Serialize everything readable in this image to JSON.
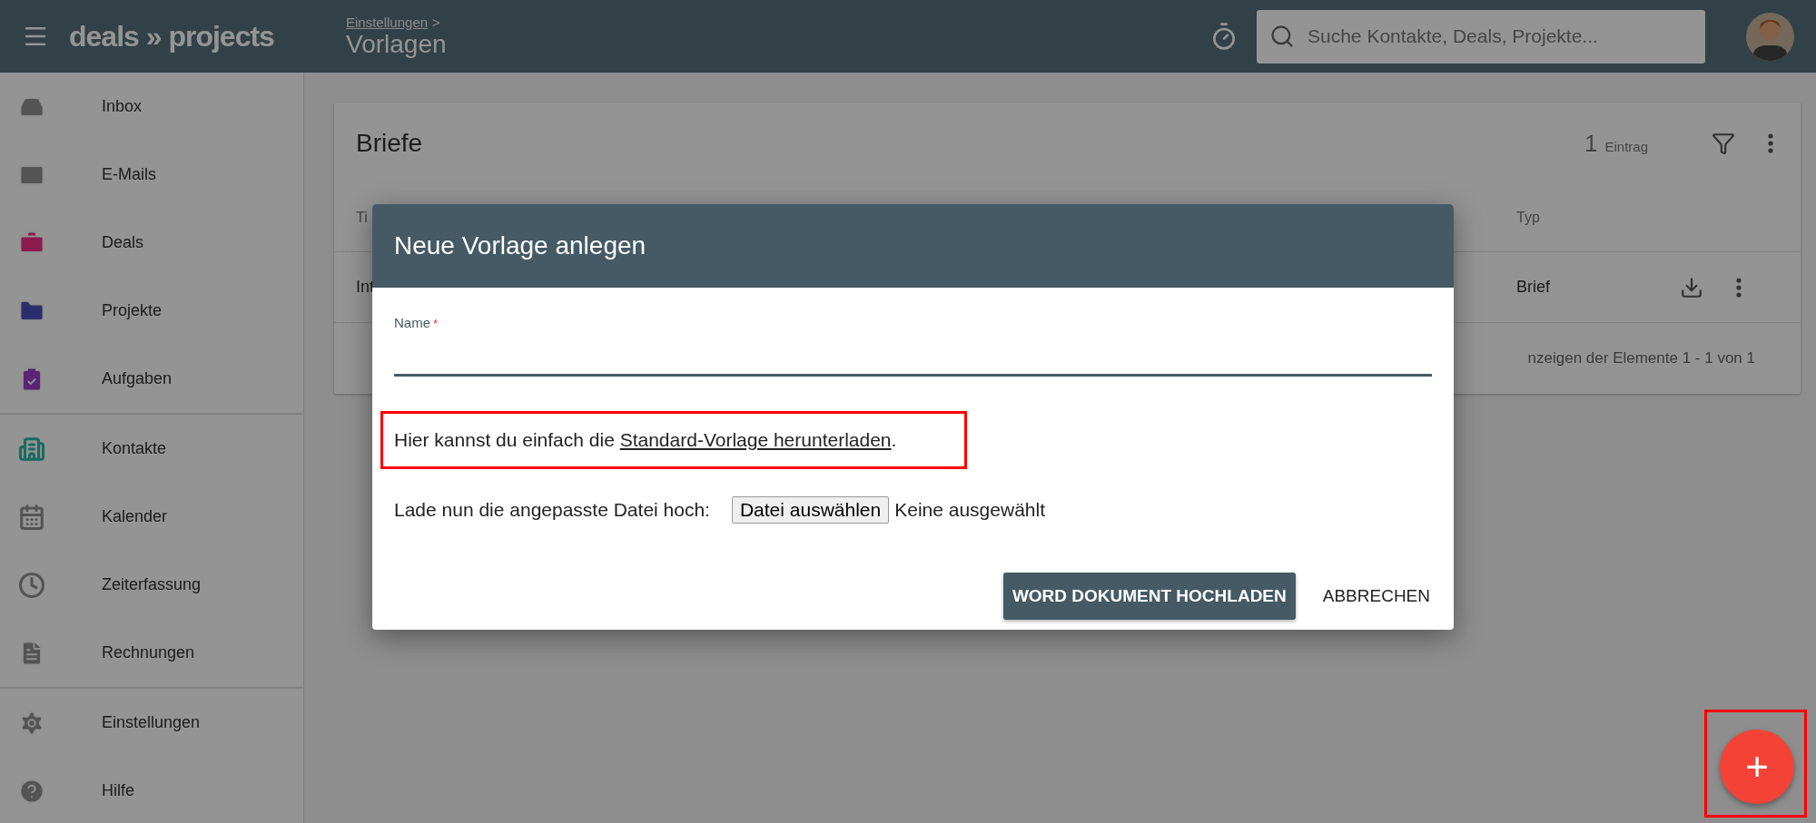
{
  "header": {
    "logo": "deals » projects",
    "breadcrumb": "Einstellungen",
    "breadcrumb_sep": ">",
    "title": "Vorlagen",
    "search": {
      "placeholder": "Suche Kontakte, Deals, Projekte..."
    }
  },
  "sidebar": {
    "groups": [
      [
        {
          "label": "Inbox",
          "color": "#545454"
        },
        {
          "label": "E-Mails",
          "color": "#545454"
        },
        {
          "label": "Deals",
          "color": "#8a1b4a"
        },
        {
          "label": "Projekte",
          "color": "#2a2f6b"
        },
        {
          "label": "Aufgaben",
          "color": "#5c2275"
        }
      ],
      [
        {
          "label": "Kontakte",
          "color": "#1a6b5f"
        },
        {
          "label": "Kalender",
          "color": "#545454"
        },
        {
          "label": "Zeiterfassung",
          "color": "#545454"
        },
        {
          "label": "Rechnungen",
          "color": "#545454"
        }
      ],
      [
        {
          "label": "Einstellungen",
          "color": "#545454"
        },
        {
          "label": "Hilfe",
          "color": "#545454"
        }
      ]
    ]
  },
  "card": {
    "title": "Briefe",
    "count": "1",
    "count_label": "Eintrag",
    "columns": [
      "Ti",
      "Typ"
    ],
    "rows": [
      {
        "column_1": "Int",
        "type": "Brief"
      }
    ],
    "pagination": "nzeigen der Elemente 1 - 1 von 1"
  },
  "dialog": {
    "title": "Neue Vorlage anlegen",
    "name_label": "Name",
    "required_mark": "*",
    "hint_before": "Hier kannst du einfach die",
    "hint_link": "Standard-Vorlage herunterladen",
    "hint_after": ".",
    "upload_label": "Lade nun die angepasste Datei hoch:",
    "file_button": "Datei auswählen",
    "file_status": "Keine ausgewählt",
    "buttons": [
      {
        "label": "WORD DOKUMENT HOCHLADEN",
        "kind": "primary"
      },
      {
        "label": "ABBRECHEN",
        "kind": "flat"
      }
    ]
  },
  "fab": {
    "label": "+"
  }
}
